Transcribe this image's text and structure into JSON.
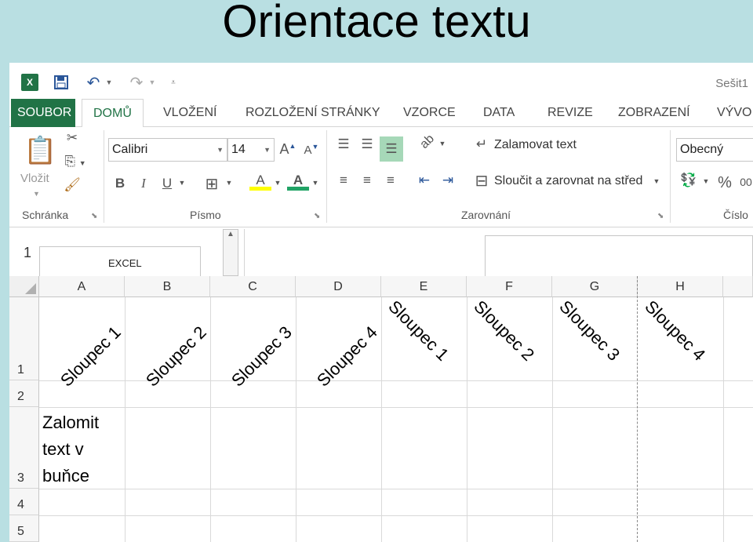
{
  "slide": {
    "title": "Orientace textu"
  },
  "titlebar": {
    "app_icon": "excel-icon",
    "app_icon_text": "X",
    "document_title": "Sešit1"
  },
  "tabs": [
    {
      "label": "SOUBOR"
    },
    {
      "label": "DOMŮ"
    },
    {
      "label": "VLOŽENÍ"
    },
    {
      "label": "ROZLOŽENÍ STRÁNKY"
    },
    {
      "label": "VZORCE"
    },
    {
      "label": "DATA"
    },
    {
      "label": "REVIZE"
    },
    {
      "label": "ZOBRAZENÍ"
    },
    {
      "label": "VÝVO"
    }
  ],
  "ribbon": {
    "clipboard": {
      "label": "Schránka",
      "paste_label": "Vložit"
    },
    "font": {
      "label": "Písmo",
      "font_name": "Calibri",
      "font_size": "14",
      "grow_label": "A",
      "shrink_label": "A",
      "bold_label": "B",
      "italic_label": "I",
      "underline_label": "U",
      "fill_label": "A",
      "font_color_label": "A"
    },
    "alignment": {
      "label": "Zarovnání",
      "wrap_text": "Zalamovat text",
      "merge_center": "Sloučit a zarovnat na střed"
    },
    "number": {
      "label": "Číslo",
      "format": "Obecný",
      "percent": "%",
      "comma": "00"
    }
  },
  "formula_bar": {
    "row_label": "1",
    "name_box": "EXCEL"
  },
  "sheet": {
    "columns": [
      "A",
      "B",
      "C",
      "D",
      "E",
      "F",
      "G",
      "H"
    ],
    "rows": [
      "1",
      "2",
      "3",
      "4",
      "5"
    ],
    "rotated_up": [
      "Sloupec 1",
      "Sloupec 2",
      "Sloupec 3",
      "Sloupec 4"
    ],
    "rotated_down": [
      "Sloupec 1",
      "Sloupec 2",
      "Sloupec 3",
      "Sloupec 4"
    ],
    "wrapped_cell": [
      "Zalomit",
      "text v",
      "buňce"
    ]
  }
}
